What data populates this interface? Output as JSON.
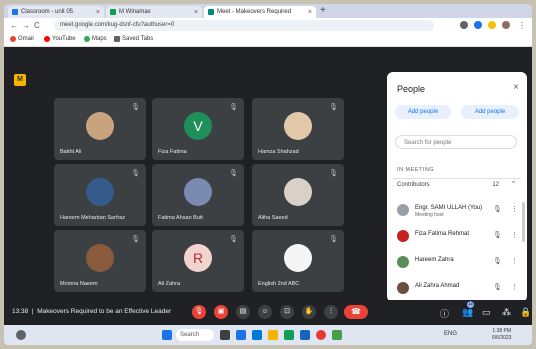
{
  "browser": {
    "tabs": [
      {
        "label": "Classroom - unit 05",
        "color": "#1a73e8"
      },
      {
        "label": "M Winamax",
        "color": "#0f9d58"
      },
      {
        "label": "Meet - Makeovers Required",
        "color": "#00897b"
      }
    ],
    "new_tab": "+",
    "back": "←",
    "forward": "→",
    "reload": "C",
    "url": "meet.google.com/kug-dsnf-cfu?authuser=0",
    "bookmarks": [
      {
        "label": "Gmail",
        "color": "#ea4335"
      },
      {
        "label": "YouTube",
        "color": "#ff0000"
      },
      {
        "label": "Maps",
        "color": "#34a853"
      },
      {
        "label": "Saved Tabs",
        "color": "#5f6368"
      }
    ]
  },
  "meet": {
    "logo_letter": "M",
    "participants": [
      {
        "name": "Bakht Ali",
        "color": "#c9a27e",
        "letter": ""
      },
      {
        "name": "Fiza Fatima",
        "color": "#1e8e5a",
        "letter": "V"
      },
      {
        "name": "Hamza Shahzad",
        "color": "#e0c8a8",
        "letter": ""
      },
      {
        "name": "Hareem Meharban Sarfraz",
        "color": "#355a8c",
        "letter": ""
      },
      {
        "name": "Fatima Ahsan Butt",
        "color": "#7a8ab0",
        "letter": ""
      },
      {
        "name": "Aliha Saeed",
        "color": "#d9d0c8",
        "letter": ""
      },
      {
        "name": "Momna Naeem",
        "color": "#8a5a3c",
        "letter": ""
      },
      {
        "name": "Ali Zahra",
        "color": "#f2d3cf",
        "letter": "R"
      },
      {
        "name": "English 2nd ABC",
        "color": "#f5f5f5",
        "letter": ""
      }
    ],
    "mic_icon": "🎙",
    "bottom": {
      "time": "13:38",
      "meeting_title": "Makeovers Required to be an Effective Leader"
    }
  },
  "people_panel": {
    "title": "People",
    "close": "×",
    "add_people_left": "Add people",
    "add_people_right": "Add people",
    "search_placeholder": "Search for people",
    "section_label": "IN MEETING",
    "contributors_label": "Contributors",
    "contributors_count": "12",
    "chevron": "^",
    "people": [
      {
        "name": "Engr. SAMI ULLAH (You)",
        "sub": "Meeting host",
        "color": "#9aa0a6"
      },
      {
        "name": "Fiza Fatima Rehmat",
        "sub": "",
        "color": "#c5221f"
      },
      {
        "name": "Hareem Zahra",
        "sub": "",
        "color": "#5a8c5a"
      },
      {
        "name": "Ali Zahra Ahmad",
        "sub": "",
        "color": "#6d4c41"
      }
    ]
  },
  "taskbar": {
    "search_label": "Search",
    "tray_text": "ENG",
    "clock_time": "1:38 PM",
    "clock_date": "6/6/2023"
  }
}
